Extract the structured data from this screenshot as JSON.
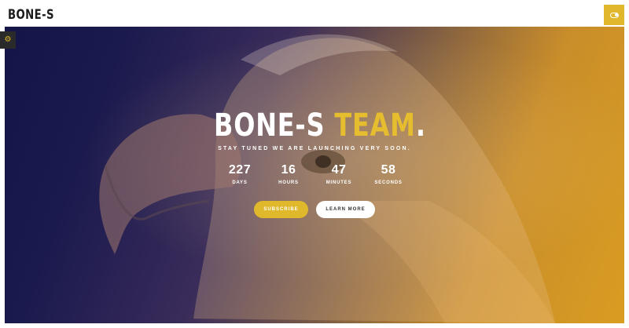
{
  "header": {
    "logo": "BONE-S"
  },
  "hero": {
    "title_main": "BONE-S ",
    "title_accent": "TEAM",
    "title_dot": ".",
    "subtitle": "STAY TUNED WE ARE LAUNCHING VERY SOON."
  },
  "countdown": [
    {
      "value": "227",
      "label": "DAYS"
    },
    {
      "value": "16",
      "label": "HOURS"
    },
    {
      "value": "47",
      "label": "MINUTES"
    },
    {
      "value": "58",
      "label": "SECONDS"
    }
  ],
  "buttons": {
    "subscribe": "SUBSCRIBE",
    "learn_more": "LEARN MORE"
  },
  "icons": {
    "corner": "toggle-icon",
    "side": "gear-icon"
  },
  "colors": {
    "accent": "#e0b82c",
    "dark": "#141448",
    "light": "#ffffff"
  }
}
